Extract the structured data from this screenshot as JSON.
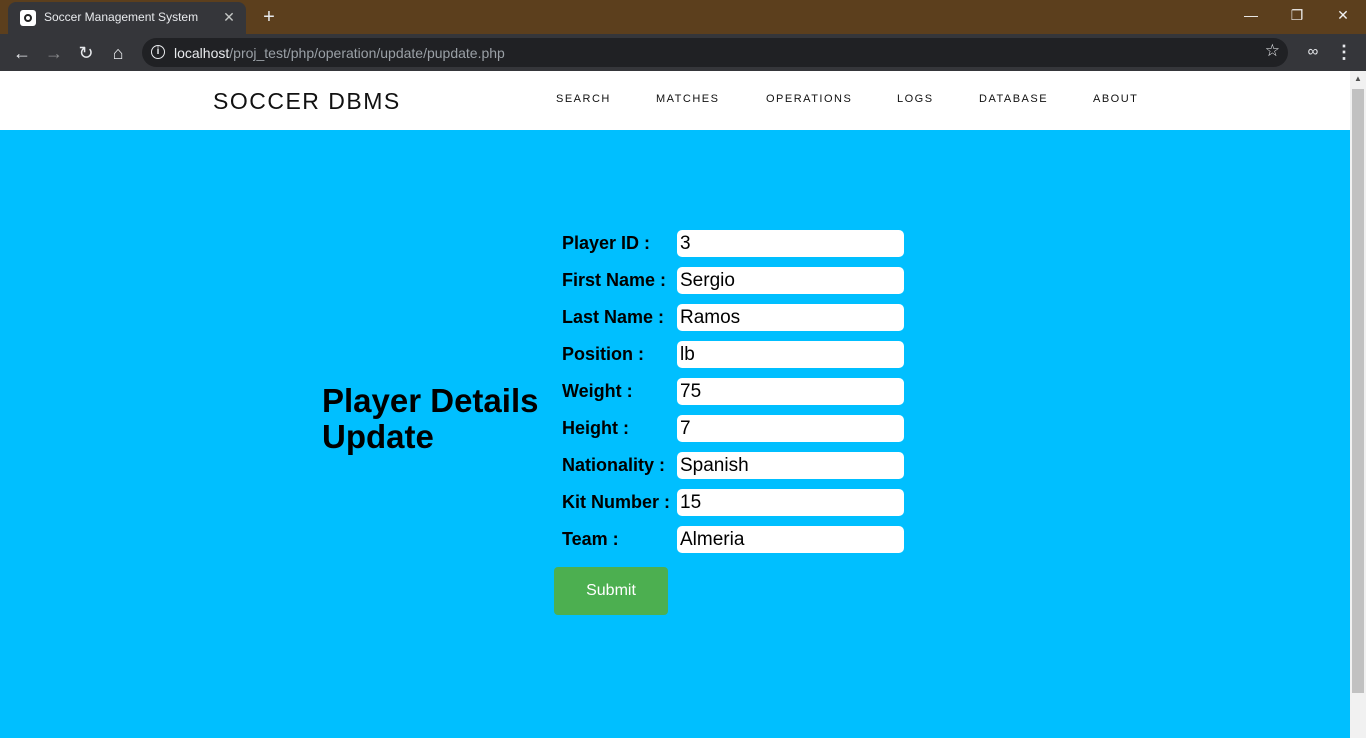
{
  "browser": {
    "tab_title": "Soccer Management System",
    "tab_close": "✕",
    "new_tab": "+",
    "url_host": "localhost",
    "url_path": "/proj_test/php/operation/update/pupdate.php",
    "window_controls": {
      "minimize": "—",
      "restore": "❐",
      "close": "✕"
    }
  },
  "navbar": {
    "brand": "SOCCER DBMS",
    "links": [
      "SEARCH",
      "MATCHES",
      "OPERATIONS",
      "LOGS",
      "DATABASE",
      "ABOUT"
    ]
  },
  "heading": "Player Details Update",
  "form": {
    "fields": [
      {
        "label": "Player ID :",
        "value": "3"
      },
      {
        "label": "First Name :",
        "value": "Sergio"
      },
      {
        "label": "Last Name :",
        "value": "Ramos"
      },
      {
        "label": "Position :",
        "value": "lb"
      },
      {
        "label": "Weight :",
        "value": "75"
      },
      {
        "label": "Height :",
        "value": "7"
      },
      {
        "label": "Nationality :",
        "value": "Spanish"
      },
      {
        "label": "Kit Number :",
        "value": "15"
      },
      {
        "label": "Team :",
        "value": "Almeria"
      }
    ],
    "submit_label": "Submit"
  },
  "colors": {
    "page_background": "#00bfff",
    "submit_button": "#4caf50",
    "titlebar": "#5c3f1d"
  }
}
